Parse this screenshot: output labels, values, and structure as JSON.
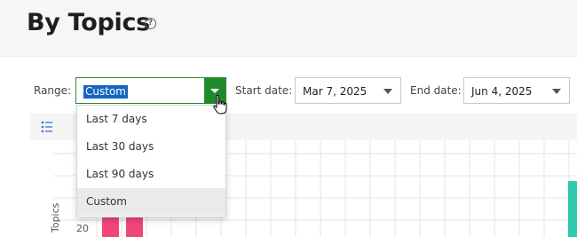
{
  "page": {
    "title": "By Topics",
    "help_icon": "help-circle-icon"
  },
  "filters": {
    "range_label": "Range:",
    "range_value": "Custom",
    "start_label": "Start date:",
    "start_value": "Mar 7, 2025",
    "end_label": "End date:",
    "end_value": "Jun 4, 2025"
  },
  "dropdown": {
    "options": [
      "Last 7 days",
      "Last 30 days",
      "Last 90 days",
      "Custom"
    ],
    "selected": "Custom"
  },
  "toolbar": {
    "icon": "list-icon"
  },
  "chart_data": {
    "type": "bar",
    "ylabel": "Topics",
    "visible_tick": "20",
    "colors": {
      "pink": "#f0467a",
      "teal": "#2ec9ae"
    }
  },
  "colors": {
    "accent_green": "#1f8a2a",
    "selection_blue": "#1565c0"
  }
}
